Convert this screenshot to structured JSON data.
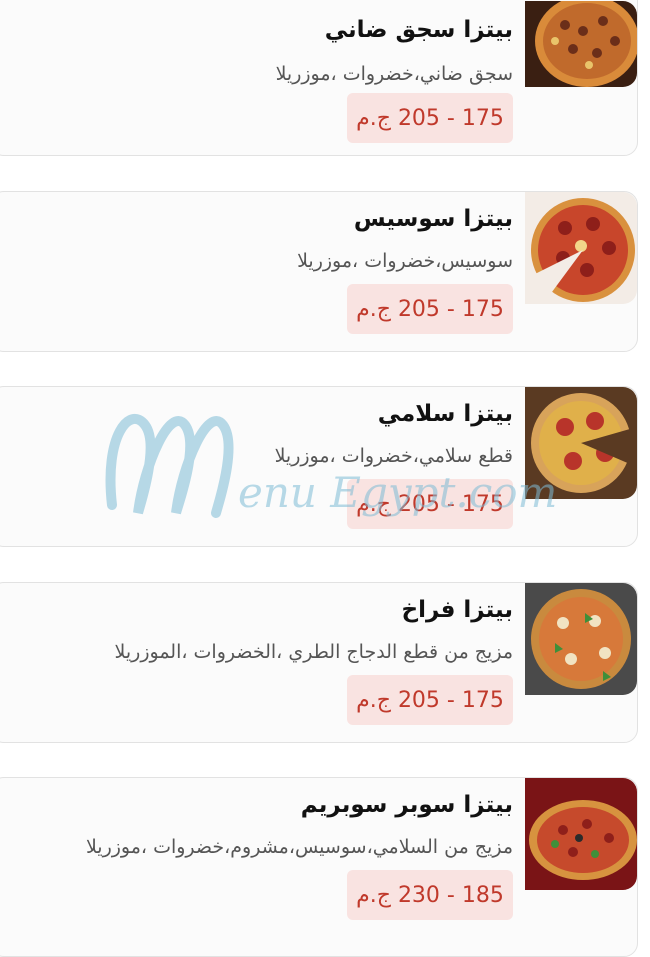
{
  "menu_items": [
    {
      "title": "بيتزا سجق ضاني",
      "description": "سجق ضاني،خضروات ،موزريلا",
      "price": "175 - 205 ج.م"
    },
    {
      "title": "بيتزا سوسيس",
      "description": "سوسيس،خضروات ،موزريلا",
      "price": "175 - 205 ج.م"
    },
    {
      "title": "بيتزا سلامي",
      "description": "قطع سلامي،خضروات ،موزريلا",
      "price": "175 - 205 ج.م"
    },
    {
      "title": "بيتزا فراخ",
      "description": "مزيج من قطع الدجاج الطري ،الخضروات ،الموزريلا",
      "price": "175 - 205 ج.م"
    },
    {
      "title": "بيتزا سوبر سوبريم",
      "description": "مزيج من السلامي،سوسيس،مشروم،خضروات ،موزريلا",
      "price": "185 - 230 ج.م"
    }
  ],
  "watermark": {
    "text": "enu Egypt.com"
  },
  "colors": {
    "price_bg": "#f9e3e1",
    "price_text": "#c0392b",
    "watermark": "#7fbcd6"
  }
}
